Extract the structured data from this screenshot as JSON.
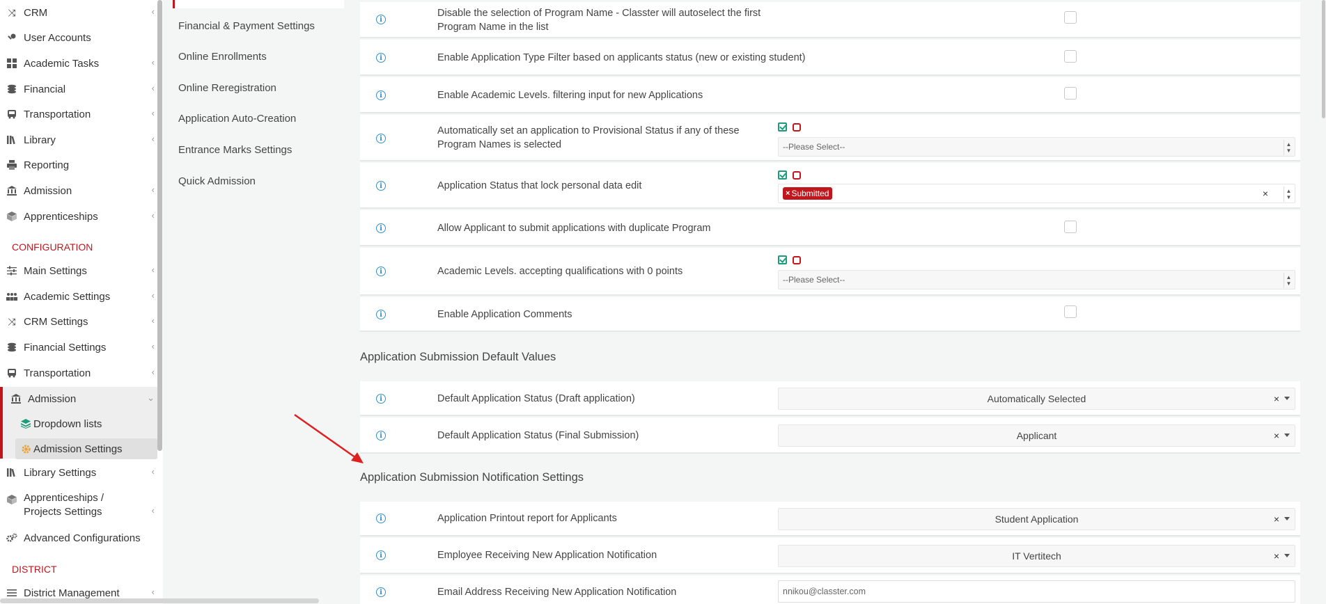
{
  "sidebar": {
    "items": [
      {
        "label": "CRM",
        "icon": "crm-icon"
      },
      {
        "label": "User Accounts",
        "icon": "key-icon"
      },
      {
        "label": "Academic Tasks",
        "icon": "grid-icon"
      },
      {
        "label": "Financial",
        "icon": "coins-icon"
      },
      {
        "label": "Transportation",
        "icon": "bus-icon"
      },
      {
        "label": "Library",
        "icon": "books-icon"
      },
      {
        "label": "Reporting",
        "icon": "printer-icon"
      },
      {
        "label": "Admission",
        "icon": "institution-icon"
      },
      {
        "label": "Apprenticeships",
        "icon": "cube-icon"
      }
    ],
    "config_heading": "CONFIGURATION",
    "config_items": [
      {
        "label": "Main Settings",
        "icon": "sliders-icon"
      },
      {
        "label": "Academic Settings",
        "icon": "users-icon"
      },
      {
        "label": "CRM Settings",
        "icon": "crm-icon"
      },
      {
        "label": "Financial Settings",
        "icon": "coins-icon"
      },
      {
        "label": "Transportation",
        "icon": "bus-icon"
      },
      {
        "label": "Admission",
        "icon": "institution-icon"
      }
    ],
    "admission_sub": [
      {
        "label": "Dropdown lists",
        "icon": "layers-icon"
      },
      {
        "label": "Admission Settings",
        "icon": "gear-icon"
      }
    ],
    "config_items_after": [
      {
        "label": "Library Settings",
        "icon": "books-icon"
      },
      {
        "label": "Apprenticeships / Projects Settings",
        "icon": "cube-icon"
      },
      {
        "label": "Advanced Configurations",
        "icon": "gears-icon"
      }
    ],
    "district_heading": "DISTRICT",
    "district_items": [
      {
        "label": "District Management",
        "icon": "list-icon"
      }
    ]
  },
  "subnav": {
    "links": [
      "Financial & Payment Settings",
      "Online Enrollments",
      "Online Reregistration",
      "Application Auto-Creation",
      "Entrance Marks Settings",
      "Quick Admission"
    ]
  },
  "settings": {
    "rows": [
      {
        "label": "Disable the selection of Program Name - Classter will autoselect the first Program Name in the list",
        "type": "checkbox",
        "checked": false
      },
      {
        "label": "Enable Application Type Filter based on applicants status (new or existing student)",
        "type": "checkbox",
        "checked": false
      },
      {
        "label": "Enable Academic Levels. filtering input for new Applications",
        "type": "checkbox",
        "checked": false
      },
      {
        "label": "Automatically set an application to Provisional Status if any of these Program Names is selected",
        "type": "multiselect",
        "placeholder": "--Please Select--"
      },
      {
        "label": "Application Status that lock personal data edit",
        "type": "multiselect",
        "tag": "Submitted",
        "clear": "×"
      },
      {
        "label": "Allow Applicant to submit applications with duplicate Program",
        "type": "checkbox",
        "checked": false
      },
      {
        "label": "Academic Levels. accepting qualifications with 0 points",
        "type": "multiselect",
        "placeholder": "--Please Select--"
      },
      {
        "label": "Enable Application Comments",
        "type": "checkbox",
        "checked": false
      }
    ]
  },
  "defaults": {
    "title": "Application Submission Default Values",
    "rows": [
      {
        "label": "Default Application Status (Draft application)",
        "value": "Automatically Selected"
      },
      {
        "label": "Default Application Status (Final Submission)",
        "value": "Applicant"
      }
    ]
  },
  "notifications": {
    "title": "Application Submission Notification Settings",
    "rows": [
      {
        "label": "Application Printout report for Applicants",
        "value": "Student Application"
      },
      {
        "label": "Employee Receiving New Application Notification",
        "value": "IT Vertitech"
      },
      {
        "label": "Email Address Receiving New Application Notification",
        "value": "nnikou@classter.com"
      }
    ]
  },
  "glyphs": {
    "info": "i",
    "clear": "×",
    "tag_x": "×",
    "chev_left": "‹",
    "chev_down": "⌄",
    "spin_up": "▲",
    "spin_down": "▼"
  },
  "colors": {
    "accent": "#c0171f",
    "info": "#2f8fc9",
    "check": "#1c9c7a",
    "arrow": "#e02020"
  }
}
